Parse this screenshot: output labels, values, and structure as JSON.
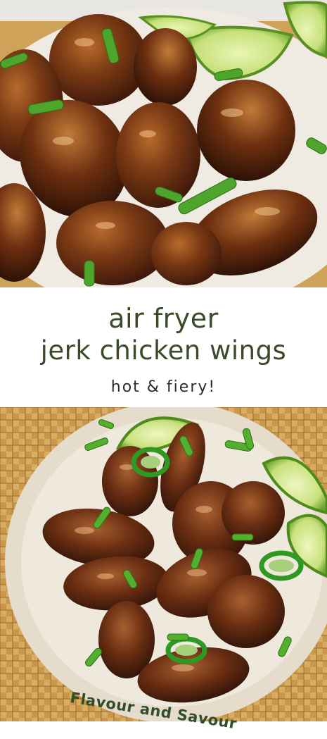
{
  "title": {
    "line1": "air fryer",
    "line2": "jerk chicken wings"
  },
  "subtitle": "hot & fiery!",
  "watermark": "Flavour and Savour",
  "colors": {
    "title_text": "#3b4a2a",
    "subtitle_text": "#2c2c2c",
    "watermark_text": "#2f4f2a",
    "wing_glaze": "#5a2a10",
    "lime": "#b8d96a",
    "scallion": "#4a9a2a",
    "plate": "#ece6da",
    "placemat": "#c89a4e"
  },
  "images": {
    "top": "glazed jerk chicken wings with lime wedges and green onion on a plate",
    "bottom": "overhead plate of glazed jerk chicken wings with jalapeño slices, lime wedges and green onion on a woven placemat"
  }
}
